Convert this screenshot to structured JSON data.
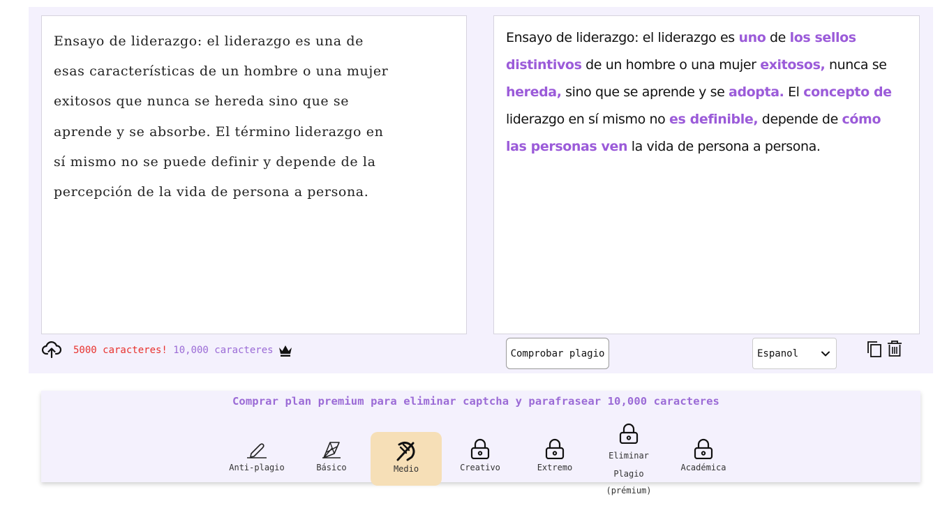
{
  "input": {
    "lines": [
      "Ensayo de liderazgo: el liderazgo es una de",
      "esas características de un hombre o una mujer",
      "exitosos que nunca se hereda sino que se",
      "aprende y se absorbe. El término liderazgo en",
      "sí mismo no se puede definir y depende de la",
      "percepción de la vida de persona a persona."
    ]
  },
  "output": {
    "segments": [
      {
        "t": "Ensayo de liderazgo: el liderazgo es ",
        "hl": false
      },
      {
        "t": "uno",
        "hl": true
      },
      {
        "t": " de ",
        "hl": false
      },
      {
        "t": "los sellos distintivos",
        "hl": true
      },
      {
        "t": " de un hombre o una mujer ",
        "hl": false
      },
      {
        "t": "exitosos,",
        "hl": true
      },
      {
        "t": " nunca se ",
        "hl": false
      },
      {
        "t": "hereda,",
        "hl": true
      },
      {
        "t": " sino que se aprende y se ",
        "hl": false
      },
      {
        "t": "adopta.",
        "hl": true
      },
      {
        "t": " El ",
        "hl": false
      },
      {
        "t": "concepto de",
        "hl": true
      },
      {
        "t": " liderazgo en sí mismo no ",
        "hl": false
      },
      {
        "t": "es definible,",
        "hl": true
      },
      {
        "t": " depende de ",
        "hl": false
      },
      {
        "t": "cómo las personas ven",
        "hl": true
      },
      {
        "t": " la vida de persona a persona.",
        "hl": false
      }
    ]
  },
  "limits": {
    "free": "5000 caracteres!",
    "premium": " 10,000 caracteres"
  },
  "actions": {
    "check_plagiarism": "Comprobar plagio",
    "language": "Espanol"
  },
  "promo": "Comprar plan premium para eliminar captcha y parafrasear 10,000 caracteres",
  "modes": [
    {
      "label": "Anti-plagio",
      "icon": "pen-icon"
    },
    {
      "label": "Básico",
      "icon": "pen-nib-icon"
    },
    {
      "label": "Medio",
      "icon": "feather-icon",
      "active": true
    },
    {
      "label": "Creativo",
      "icon": "lock-icon"
    },
    {
      "label": "Extremo",
      "icon": "lock-icon"
    },
    {
      "label": "Eliminar Plagio (prémium)",
      "lines": [
        "Eliminar",
        "Plagio",
        "(prémium)"
      ],
      "icon": "lock-icon"
    },
    {
      "label": "Académica",
      "icon": "lock-icon"
    }
  ],
  "colors": {
    "panel_bg": "#f4f1fd",
    "highlight": "#9b5bd9",
    "active_mode": "#f6dfb7",
    "limit_red": "#e8322e",
    "limit_purple": "#9b6bd6"
  }
}
